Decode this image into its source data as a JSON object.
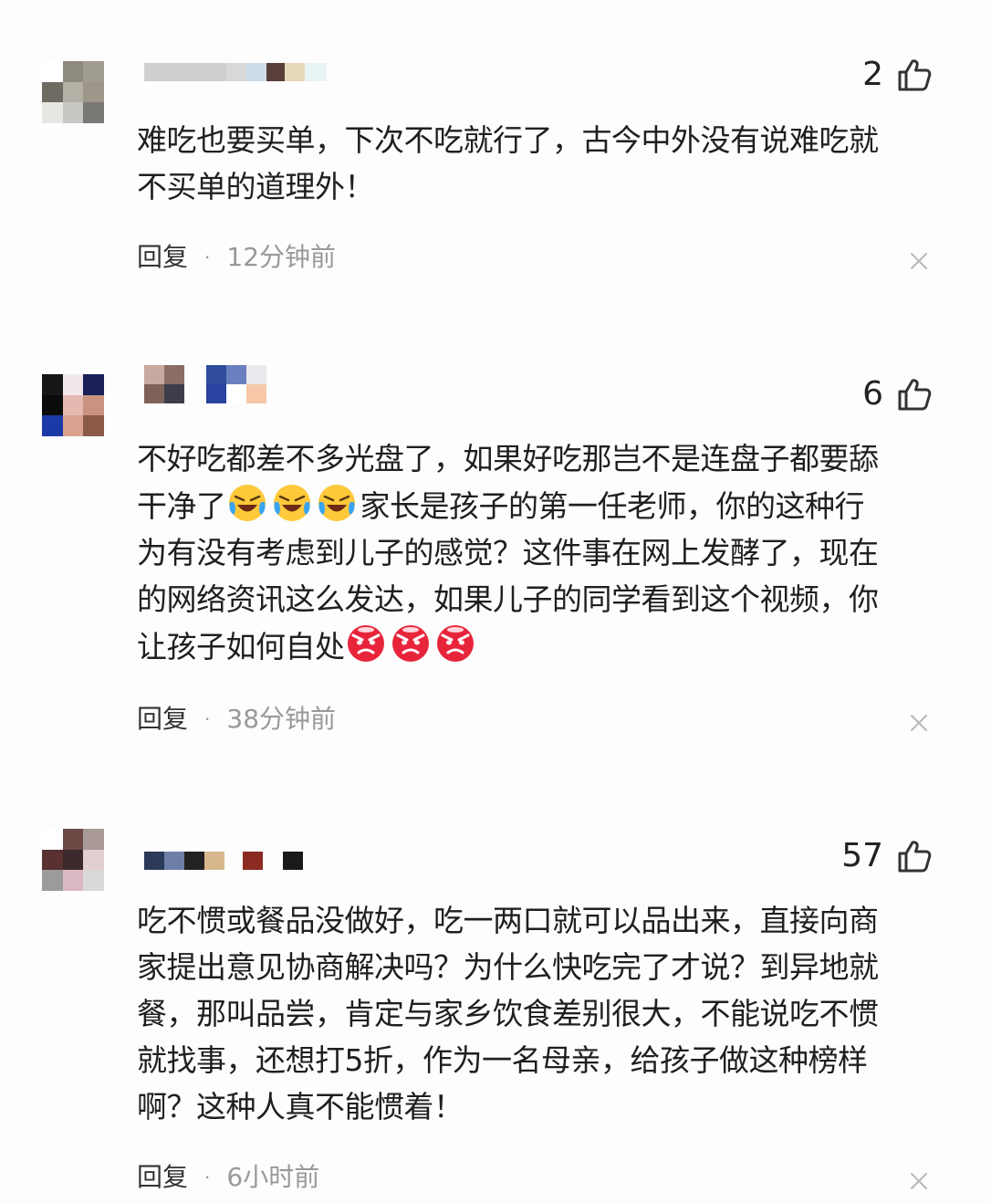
{
  "comments": [
    {
      "likes": "2",
      "text_lines": [
        "难吃也要买单，下次不吃就行了，古今中外没有说难吃就",
        "不买单的道理外！"
      ],
      "reply_label": "回复",
      "separator": "·",
      "time": "12分钟前",
      "like_icon": "thumbs-up-icon",
      "close_icon": "close-icon"
    },
    {
      "likes": "6",
      "text_lines": [
        "不好吃都差不多光盘了，如果好吃那岂不是连盘子都要舔",
        "干净了",
        "家长是孩子的第一任老师，你的这种行",
        "为有没有考虑到儿子的感觉？这件事在网上发酵了，现在",
        "的网络资讯这么发达，如果儿子的同学看到这个视频，你",
        "让孩子如何自处"
      ],
      "emojis": [
        "laughing-crying-emoji",
        "angry-face-emoji"
      ],
      "reply_label": "回复",
      "separator": "·",
      "time": "38分钟前",
      "like_icon": "thumbs-up-icon",
      "close_icon": "close-icon"
    },
    {
      "likes": "57",
      "text_lines": [
        "吃不惯或餐品没做好，吃一两口就可以品出来，直接向商",
        "家提出意见协商解决吗？为什么快吃完了才说？到异地就",
        "餐，那叫品尝，肯定与家乡饮食差别很大，不能说吃不惯",
        "就找事，还想打5折，作为一名母亲，给孩子做这种榜样",
        "啊？这种人真不能惯着！"
      ],
      "reply_label": "回复",
      "separator": "·",
      "time": "6小时前",
      "like_icon": "thumbs-up-icon",
      "close_icon": "close-icon"
    }
  ],
  "colors": {
    "text": "#1f1f1f",
    "meta_gray": "#999999",
    "icon_stroke": "#333333",
    "close_gray": "#bbbbbb"
  }
}
